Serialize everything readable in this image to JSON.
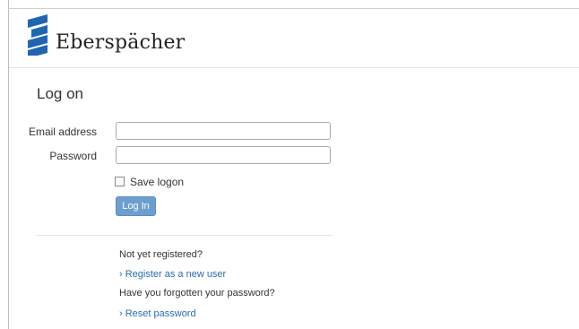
{
  "header": {
    "brand_name": "Eberspächer",
    "logo_icon": "eberspaecher-logo-icon",
    "brand_color": "#1f66b2"
  },
  "login": {
    "title": "Log on",
    "email_label": "Email address",
    "email_value": "",
    "password_label": "Password",
    "password_value": "",
    "save_logon_label": "Save logon",
    "save_logon_checked": false,
    "login_button": "Log In",
    "button_color": "#6d9ed0"
  },
  "register": {
    "prompt": "Not yet registered?",
    "link": "› Register as a new user"
  },
  "reset": {
    "prompt": "Have you forgotten your password?",
    "link": "› Reset password"
  },
  "link_color": "#2a6cb0"
}
